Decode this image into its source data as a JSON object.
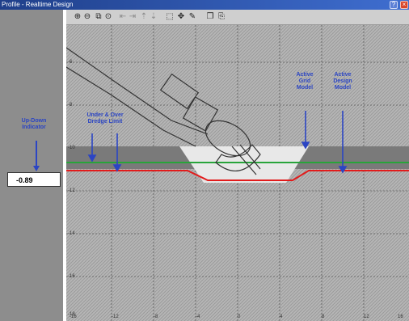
{
  "window": {
    "title": "Profile - Realtime Design",
    "help_glyph": "?",
    "close_glyph": "×"
  },
  "toolbar": {
    "tools": [
      {
        "name": "zoom-in-icon",
        "glyph": "⊕",
        "enabled": true
      },
      {
        "name": "zoom-out-icon",
        "glyph": "⊖",
        "enabled": true
      },
      {
        "name": "zoom-window-icon",
        "glyph": "⧉",
        "enabled": true
      },
      {
        "name": "zoom-extents-icon",
        "glyph": "⊙",
        "enabled": true
      },
      {
        "name": "pan-left-icon",
        "glyph": "⇤",
        "enabled": false
      },
      {
        "name": "pan-right-icon",
        "glyph": "⇥",
        "enabled": false
      },
      {
        "name": "pan-up-icon",
        "glyph": "⇡",
        "enabled": false
      },
      {
        "name": "pan-down-icon",
        "glyph": "⇣",
        "enabled": false
      },
      {
        "name": "select-icon",
        "glyph": "⬚",
        "enabled": true
      },
      {
        "name": "move-icon",
        "glyph": "✥",
        "enabled": true
      },
      {
        "name": "draw-icon",
        "glyph": "✎",
        "enabled": true
      },
      {
        "name": "copy-icon",
        "glyph": "❐",
        "enabled": true
      },
      {
        "name": "paste-icon",
        "glyph": "⎘",
        "enabled": true
      }
    ]
  },
  "left_panel": {
    "indicator_label": "Up-Down Indicator",
    "depth_value": "-0.89"
  },
  "plot": {
    "labels": {
      "under_over": "Under & Over Dredge Limit",
      "active_grid": "Active Grid Model",
      "active_design": "Active Design Model"
    },
    "y_ticks": [
      "-6",
      "-8",
      "-10",
      "-12",
      "-14",
      "-16",
      "-18"
    ],
    "x_ticks": [
      "-16",
      "-12",
      "-8",
      "-4",
      "0",
      "4",
      "8",
      "12",
      "16"
    ],
    "colors": {
      "background": "#b4b4b4",
      "grid_lines": "#5a5a5a",
      "dredge_area": "#e8e8e8",
      "grid_model": "#737373",
      "design_model": "#e21b1b",
      "over_limit": "#28a43a",
      "arrow": "#2b45c4"
    }
  }
}
